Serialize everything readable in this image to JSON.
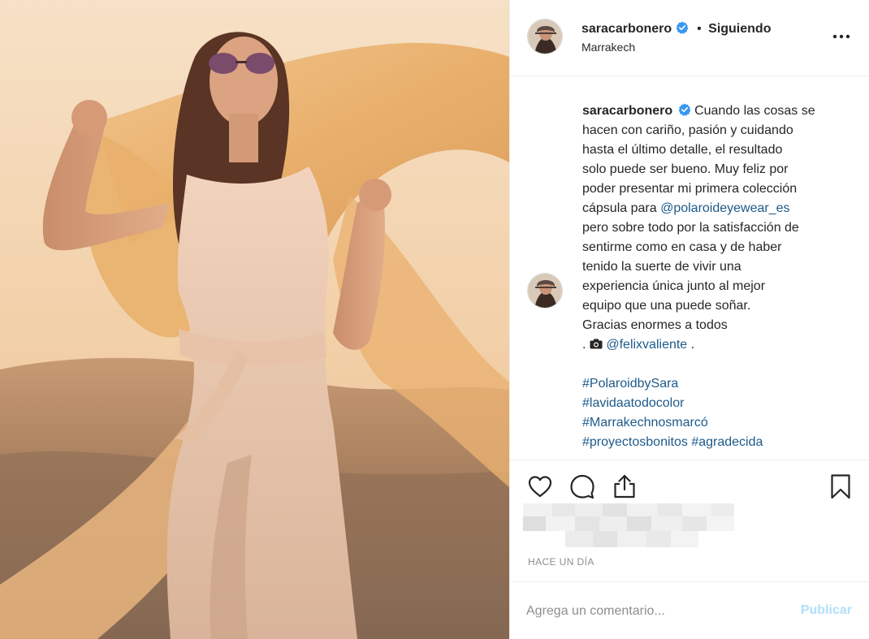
{
  "post": {
    "photo_icon": "woman-in-desert-photo",
    "username": "saracarbonero",
    "follow_separator": "•",
    "follow_status": "Siguiendo",
    "location": "Marrakech",
    "more_icon": "more-horizontal-icon",
    "verified_color": "#3897f0"
  },
  "caption": {
    "username": "saracarbonero",
    "text_lines": [
      "Cuando las cosas se",
      "hacen con cariño, pasión y cuidando",
      "hasta el último detalle, el resultado",
      "solo puede ser bueno. Muy feliz por",
      "poder presentar mi primera colección",
      "cápsula para"
    ],
    "mention_1": "@polaroideyewear_es",
    "text_lines_2": [
      "pero sobre todo por la satisfacción de",
      "sentirme como en casa y de haber",
      "tenido la suerte de vivir una",
      "experiencia única junto al mejor",
      "equipo que una puede soñar.",
      "Gracias enormes a todos"
    ],
    "credit_prefix": ".",
    "credit_icon": "camera-icon",
    "mention_2": "@felixvaliente",
    "credit_suffix": ".",
    "hashtags": [
      "#PolaroidbySara",
      "#lavidaatodocolor",
      "#Marrakechnosmarcó",
      "#proyectosbonitos"
    ],
    "hashtag_extra": "#agradecida"
  },
  "actions": {
    "like_icon": "heart-icon",
    "comment_icon": "comment-bubble-icon",
    "share_icon": "share-upload-icon",
    "save_icon": "bookmark-icon"
  },
  "timestamp": "HACE UN DÍA",
  "comment": {
    "placeholder": "Agrega un comentario...",
    "publish_label": "Publicar"
  },
  "colors": {
    "text": "#262626",
    "muted": "#8e8e8e",
    "link": "#1d5a8a",
    "publish_disabled": "#b2dffc",
    "border": "#efefef"
  }
}
